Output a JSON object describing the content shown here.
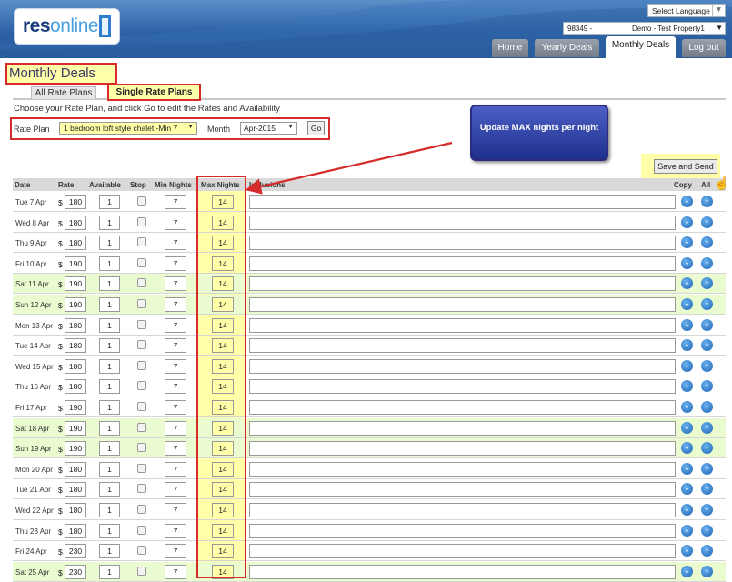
{
  "header": {
    "logo": {
      "res": "res",
      "online": "online"
    },
    "language_select": "Select Language",
    "property_select": {
      "code": "98349 -",
      "name": "Demo - Test Property1"
    },
    "nav": [
      "Home",
      "Yearly Deals",
      "Monthly Deals",
      "Log out"
    ],
    "active_nav": "Monthly Deals"
  },
  "page": {
    "title": "Monthly Deals",
    "subtabs": [
      "All Rate Plans",
      "Single Rate Plans"
    ],
    "instructions": "Choose your Rate Plan, and click Go to edit the Rates and Availability",
    "rate_plan_label": "Rate Plan",
    "rate_plan_value": "1 bedroom loft style chalet -Min 7",
    "month_label": "Month",
    "month_value": "Apr-2015",
    "go_label": "Go",
    "save_label": "Save and Send",
    "callout": "Update MAX nights per night"
  },
  "table": {
    "headers": {
      "date": "Date",
      "rate": "Rate",
      "available": "Available",
      "stop": "Stop",
      "min": "Min Nights",
      "max": "Max Nights",
      "inclusions": "Inclusions",
      "copy": "Copy",
      "all": "All"
    },
    "currency": "$",
    "rows": [
      {
        "date": "Tue 7 Apr",
        "rate": "180",
        "available": "1",
        "min": "7",
        "max": "14",
        "weekend": false
      },
      {
        "date": "Wed 8 Apr",
        "rate": "180",
        "available": "1",
        "min": "7",
        "max": "14",
        "weekend": false
      },
      {
        "date": "Thu 9 Apr",
        "rate": "180",
        "available": "1",
        "min": "7",
        "max": "14",
        "weekend": false
      },
      {
        "date": "Fri 10 Apr",
        "rate": "190",
        "available": "1",
        "min": "7",
        "max": "14",
        "weekend": false
      },
      {
        "date": "Sat 11 Apr",
        "rate": "190",
        "available": "1",
        "min": "7",
        "max": "14",
        "weekend": true
      },
      {
        "date": "Sun 12 Apr",
        "rate": "190",
        "available": "1",
        "min": "7",
        "max": "14",
        "weekend": true
      },
      {
        "date": "Mon 13 Apr",
        "rate": "180",
        "available": "1",
        "min": "7",
        "max": "14",
        "weekend": false
      },
      {
        "date": "Tue 14 Apr",
        "rate": "180",
        "available": "1",
        "min": "7",
        "max": "14",
        "weekend": false
      },
      {
        "date": "Wed 15 Apr",
        "rate": "180",
        "available": "1",
        "min": "7",
        "max": "14",
        "weekend": false
      },
      {
        "date": "Thu 16 Apr",
        "rate": "180",
        "available": "1",
        "min": "7",
        "max": "14",
        "weekend": false
      },
      {
        "date": "Fri 17 Apr",
        "rate": "190",
        "available": "1",
        "min": "7",
        "max": "14",
        "weekend": false
      },
      {
        "date": "Sat 18 Apr",
        "rate": "190",
        "available": "1",
        "min": "7",
        "max": "14",
        "weekend": true
      },
      {
        "date": "Sun 19 Apr",
        "rate": "190",
        "available": "1",
        "min": "7",
        "max": "14",
        "weekend": true
      },
      {
        "date": "Mon 20 Apr",
        "rate": "180",
        "available": "1",
        "min": "7",
        "max": "14",
        "weekend": false
      },
      {
        "date": "Tue 21 Apr",
        "rate": "180",
        "available": "1",
        "min": "7",
        "max": "14",
        "weekend": false
      },
      {
        "date": "Wed 22 Apr",
        "rate": "180",
        "available": "1",
        "min": "7",
        "max": "14",
        "weekend": false
      },
      {
        "date": "Thu 23 Apr",
        "rate": "180",
        "available": "1",
        "min": "7",
        "max": "14",
        "weekend": false
      },
      {
        "date": "Fri 24 Apr",
        "rate": "230",
        "available": "1",
        "min": "7",
        "max": "14",
        "weekend": false
      },
      {
        "date": "Sat 25 Apr",
        "rate": "230",
        "available": "1",
        "min": "7",
        "max": "14",
        "weekend": true
      }
    ]
  }
}
